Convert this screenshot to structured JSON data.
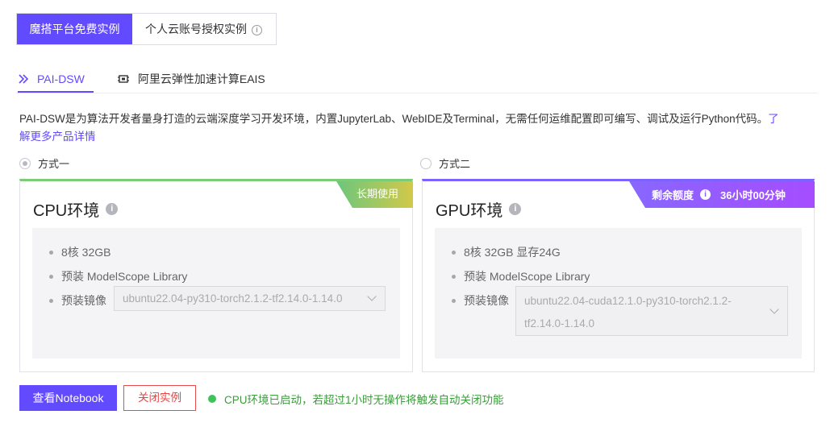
{
  "top_tabs": [
    {
      "label": "魔搭平台免费实例"
    },
    {
      "label": "个人云账号授权实例"
    }
  ],
  "sub_tabs": [
    {
      "label": "PAI-DSW"
    },
    {
      "label": "阿里云弹性加速计算EAIS"
    }
  ],
  "description": {
    "text": "PAI-DSW是为算法开发者量身打造的云端深度学习开发环境，内置JupyterLab、WebIDE及Terminal，无需任何运维配置即可编写、调试及运行Python代码。",
    "link_part1": "了",
    "link_part2": "解更多产品详情"
  },
  "options": [
    {
      "label": "方式一",
      "selected": true
    },
    {
      "label": "方式二",
      "selected": false
    }
  ],
  "cpu_card": {
    "title": "CPU环境",
    "badge": "长期使用",
    "specs": [
      "8核 32GB",
      "预装 ModelScope Library"
    ],
    "image_label": "预装镜像",
    "image_value": "ubuntu22.04-py310-torch2.1.2-tf2.14.0-1.14.0"
  },
  "gpu_card": {
    "title": "GPU环境",
    "badge_label": "剩余额度",
    "badge_value": "36小时00分钟",
    "specs": [
      "8核 32GB 显存24G",
      "预装 ModelScope Library"
    ],
    "image_label": "预装镜像",
    "image_value_line1": "ubuntu22.04-cuda12.1.0-py310-torch2.1.2-",
    "image_value_line2": "tf2.14.0-1.14.0"
  },
  "actions": {
    "view_notebook": "查看Notebook",
    "close_instance": "关闭实例"
  },
  "status_text": "CPU环境已启动，若超过1小时无操作将触发自动关闭功能",
  "colors": {
    "accent": "#624aff",
    "cpu_badge": "#7ccb76",
    "gpu_badge": "#8867ff",
    "danger": "#e64545",
    "success": "#3ec25a"
  }
}
